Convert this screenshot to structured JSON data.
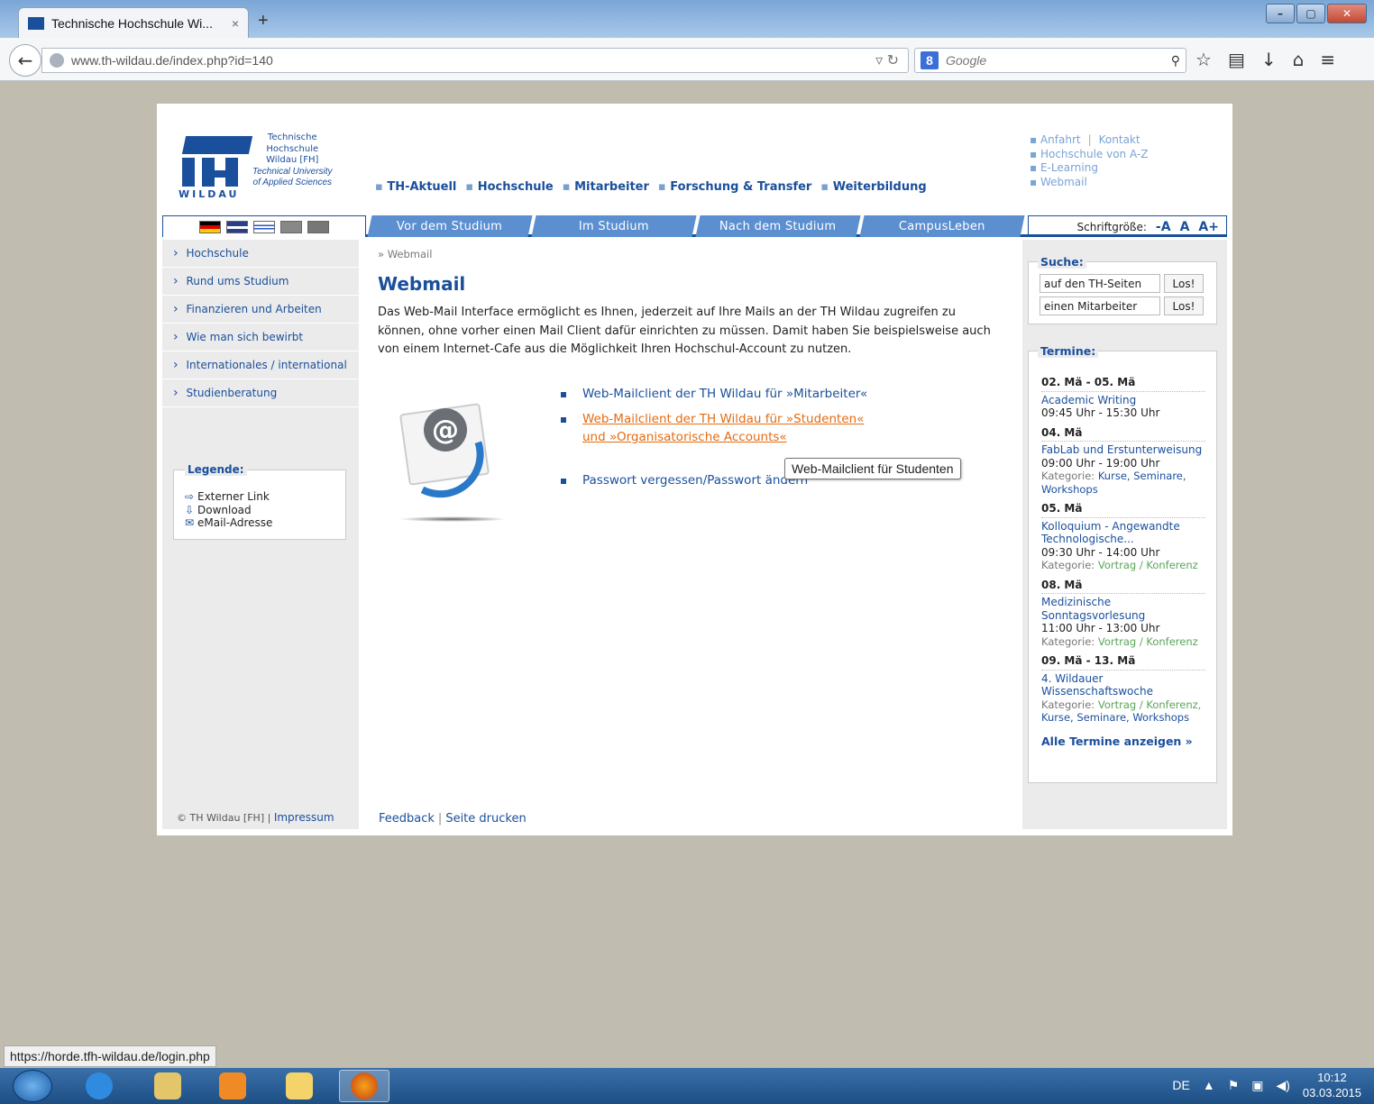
{
  "browser": {
    "tab_title": "Technische Hochschule Wi...",
    "tab_close": "×",
    "new_tab": "+",
    "url": "www.th-wildau.de/index.php?id=140",
    "search_placeholder": "Google",
    "status_url": "https://horde.tfh-wildau.de/login.php"
  },
  "logo": {
    "line1": "Technische",
    "line2": "Hochschule",
    "line3": "Wildau [FH]",
    "line4": "Technical University",
    "line5": "of Applied Sciences",
    "wildau": "WILDAU"
  },
  "mainnav": [
    "TH-Aktuell",
    "Hochschule",
    "Mitarbeiter",
    "Forschung & Transfer",
    "Weiterbildung"
  ],
  "servicenav": {
    "anfahrt": "Anfahrt",
    "kontakt": "Kontakt",
    "az": "Hochschule von A-Z",
    "elearning": "E-Learning",
    "webmail": "Webmail"
  },
  "tabs": [
    "Vor dem Studium",
    "Im Studium",
    "Nach dem Studium",
    "CampusLeben"
  ],
  "fontsize": {
    "label": "Schriftgröße:",
    "smaller": "-A",
    "normal": "A",
    "bigger": "A+"
  },
  "sidebar": {
    "items": [
      "Hochschule",
      "Rund ums Studium",
      "Finanzieren und Arbeiten",
      "Wie man sich bewirbt",
      "Internationales / international",
      "Studienberatung"
    ],
    "legend_title": "Legende:",
    "legend": [
      "Externer Link",
      "Download",
      "eMail-Adresse"
    ],
    "footer": "© TH Wildau [FH] |",
    "impressum": "Impressum"
  },
  "content": {
    "breadcrumb": "» Webmail",
    "title": "Webmail",
    "intro": "Das Web-Mail Interface ermöglicht es Ihnen, jederzeit auf Ihre Mails an der TH Wildau zugreifen zu können, ohne vorher einen Mail Client dafür einrichten zu müssen. Damit haben Sie beispielsweise auch von einem Internet-Cafe aus die Möglichkeit Ihren Hochschul-Account zu nutzen.",
    "link_mitarbeiter": "Web-Mailclient der TH Wildau für »Mitarbeiter«",
    "link_studenten_1": "Web-Mailclient der TH Wildau für »Studenten«",
    "link_studenten_2": "und »Organisatorische Accounts«",
    "link_passwort": "Passwort vergessen/Passwort ändern",
    "tooltip": "Web-Mailclient für Studenten",
    "feedback": "Feedback",
    "print": "Seite drucken"
  },
  "search": {
    "title": "Suche:",
    "field1": "auf den TH-Seiten",
    "field2": "einen Mitarbeiter",
    "button": "Los!"
  },
  "termine": {
    "title": "Termine:",
    "events": [
      {
        "date": "02. Mä - 05. Mä",
        "title": "Academic Writing",
        "time": "09:45 Uhr - 15:30 Uhr"
      },
      {
        "date": "04. Mä",
        "title": "FabLab und Erstunterweisung",
        "time": "09:00 Uhr - 19:00 Uhr",
        "cat_label": "Kategorie:",
        "cat": "Kurse, Seminare, Workshops"
      },
      {
        "date": "05. Mä",
        "title": "Kolloquium - Angewandte Technologische...",
        "time": "09:30 Uhr - 14:00 Uhr",
        "cat_label": "Kategorie:",
        "cat": "Vortrag / Konferenz"
      },
      {
        "date": "08. Mä",
        "title": "Medizinische Sonntagsvorlesung",
        "time": "11:00 Uhr - 13:00 Uhr",
        "cat_label": "Kategorie:",
        "cat": "Vortrag / Konferenz"
      },
      {
        "date": "09. Mä - 13. Mä",
        "title": "4. Wildauer Wissenschaftswoche",
        "cat_label": "Kategorie:",
        "cat_a": "Vortrag / Konferenz,",
        "cat_b": "Kurse, Seminare, Workshops"
      }
    ],
    "all": "Alle Termine anzeigen »"
  },
  "taskbar": {
    "lang": "DE",
    "time": "10:12",
    "date": "03.03.2015"
  }
}
